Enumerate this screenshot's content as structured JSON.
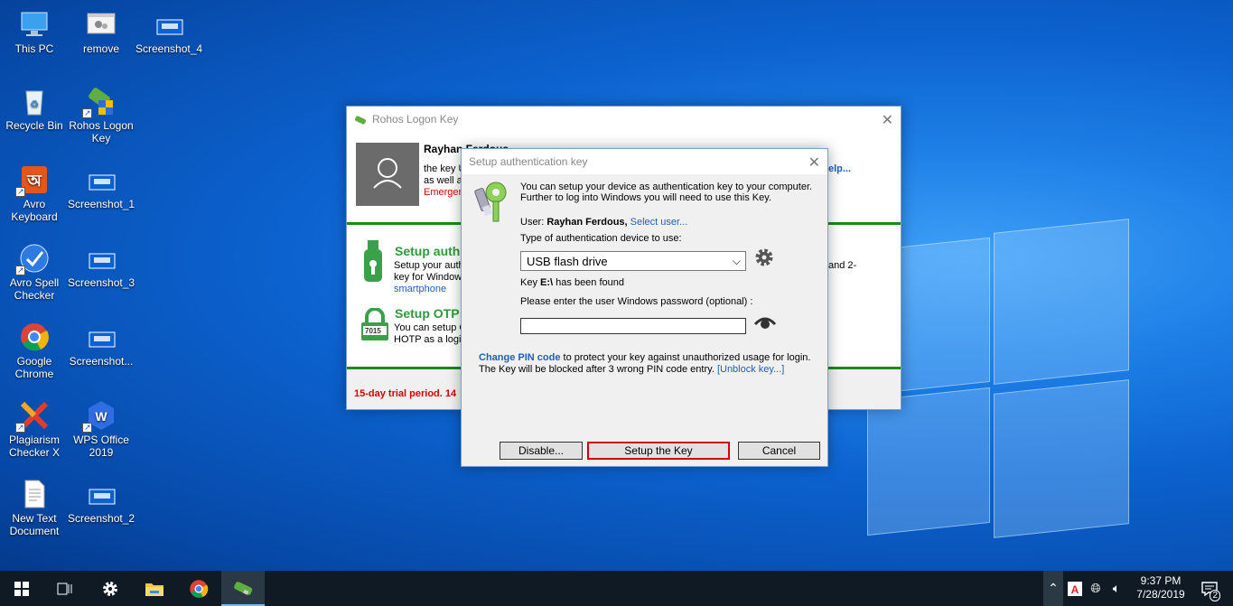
{
  "desktop": {
    "icons": [
      {
        "label": "This PC",
        "icon": "computer-icon"
      },
      {
        "label": "remove",
        "icon": "window-icon"
      },
      {
        "label": "Screenshot_4",
        "icon": "image-file-icon"
      },
      {
        "label": "Recycle Bin",
        "icon": "recycle-bin-icon"
      },
      {
        "label": "Rohos Logon Key",
        "icon": "rohos-icon"
      },
      {
        "label": "Avro Keyboard",
        "icon": "avro-icon"
      },
      {
        "label": "Screenshot_1",
        "icon": "image-file-icon"
      },
      {
        "label": "Avro Spell Checker",
        "icon": "spellcheck-icon"
      },
      {
        "label": "Screenshot_3",
        "icon": "image-file-icon"
      },
      {
        "label": "Google Chrome",
        "icon": "chrome-icon"
      },
      {
        "label": "Screenshot...",
        "icon": "image-file-icon"
      },
      {
        "label": "Plagiarism Checker X",
        "icon": "plagiarism-icon"
      },
      {
        "label": "WPS Office 2019",
        "icon": "wps-icon"
      },
      {
        "label": "New Text Document",
        "icon": "text-file-icon"
      },
      {
        "label": "Screenshot_2",
        "icon": "image-file-icon"
      }
    ]
  },
  "rohos": {
    "title": "Rohos Logon Key",
    "user_name": "Rayhan Ferdous",
    "desc_line1": "the key U",
    "desc_line2": "as well as",
    "emergency": "Emergenc",
    "help_link": "elp...",
    "section1": {
      "title": "Setup auth",
      "line1": "Setup your auth",
      "line2": "key for Window",
      "link": "smartphone",
      "right_text": "and 2-"
    },
    "section2": {
      "title": "Setup OTP",
      "line1": "You can setup G",
      "line2": "HOTP as a login",
      "otp_digits": "7015"
    },
    "trial": "15-day trial period. 14"
  },
  "dialog": {
    "title": "Setup authentication key",
    "intro1": "You can setup your device as authentication key to your computer.",
    "intro2": "Further to log into Windows you will need to use this Key.",
    "user_label": "User:",
    "user_name": "Rayhan Ferdous,",
    "select_user": "Select user...",
    "device_type_label": "Type of authentication device to use:",
    "device_selected": "USB flash drive",
    "key_prefix": "Key",
    "key_drive": "E:\\",
    "key_suffix": "has been found",
    "password_label": "Please enter the user Windows password (optional) :",
    "password_value": "",
    "pin_link": "Change PIN code",
    "pin_text": "to protect your key against unauthorized usage for login.",
    "block_text": "The Key will be blocked after 3 wrong PIN code entry.",
    "unblock_link": "[Unblock key...]",
    "buttons": {
      "disable": "Disable...",
      "setup": "Setup the Key",
      "cancel": "Cancel"
    }
  },
  "taskbar": {
    "time": "9:37 PM",
    "date": "7/28/2019",
    "notifications": "2"
  }
}
